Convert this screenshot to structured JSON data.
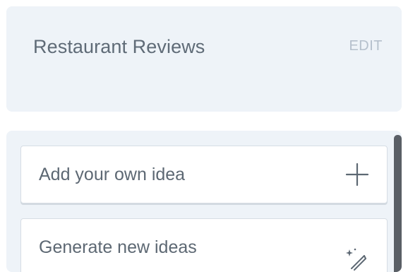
{
  "header": {
    "title": "Restaurant Reviews",
    "edit_label": "EDIT"
  },
  "ideas": {
    "add_label": "Add your own idea",
    "add_icon": "plus-icon",
    "generate_label": "Generate new ideas",
    "generate_icon": "magic-wand-icon"
  },
  "colors": {
    "panel_bg": "#eef3f8",
    "title_text": "#5f6b77",
    "edit_text": "#b5c0cc",
    "scrollbar": "#5a5f66"
  }
}
